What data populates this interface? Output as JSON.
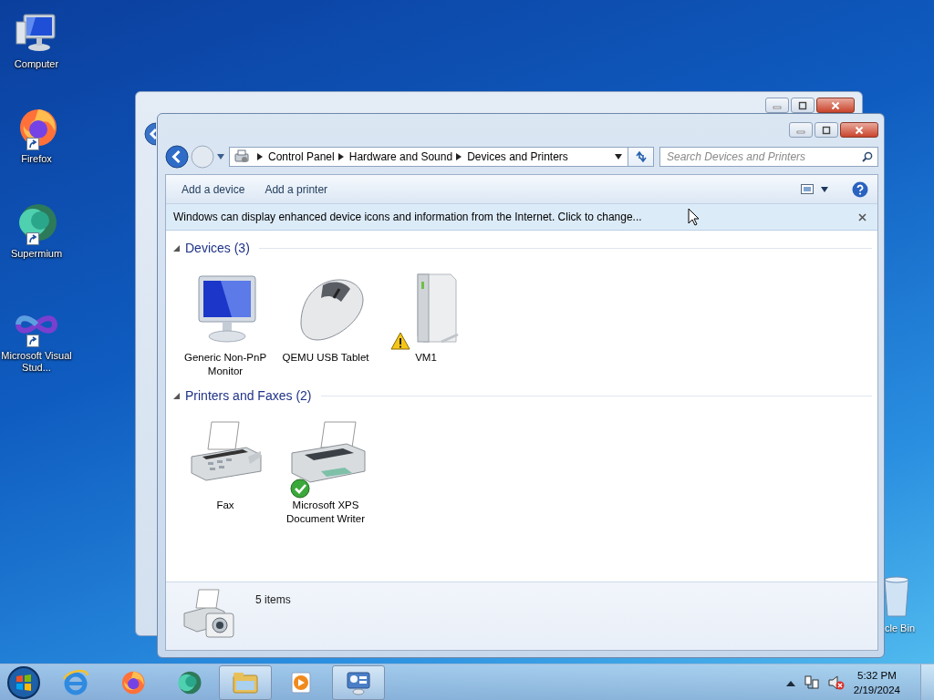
{
  "desktop_icons": [
    {
      "label": "Computer",
      "kind": "computer",
      "shortcut": false
    },
    {
      "label": "Firefox",
      "kind": "firefox",
      "shortcut": true
    },
    {
      "label": "Supermium",
      "kind": "supermium",
      "shortcut": true
    },
    {
      "label": "Microsoft Visual Stud...",
      "kind": "vs",
      "shortcut": true
    },
    {
      "label": "cle Bin",
      "kind": "recycle",
      "shortcut": false
    }
  ],
  "window": {
    "breadcrumb": [
      "Control Panel",
      "Hardware and Sound",
      "Devices and Printers"
    ],
    "search": {
      "placeholder": "Search Devices and Printers"
    },
    "toolbar": [
      "Add a device",
      "Add a printer"
    ],
    "info_bar": "Windows can display enhanced device icons and information from the Internet. Click to change...",
    "groups": [
      {
        "title": "Devices (3)",
        "expanded": true,
        "items": [
          {
            "label": "Generic Non-PnP Monitor",
            "kind": "monitor",
            "warning": false,
            "default": false
          },
          {
            "label": "QEMU USB Tablet",
            "kind": "mouse",
            "warning": false,
            "default": false
          },
          {
            "label": "VM1",
            "kind": "computer-case",
            "warning": true,
            "default": false
          }
        ]
      },
      {
        "title": "Printers and Faxes (2)",
        "expanded": true,
        "items": [
          {
            "label": "Fax",
            "kind": "fax",
            "warning": false,
            "default": false
          },
          {
            "label": "Microsoft XPS Document Writer",
            "kind": "printer",
            "warning": false,
            "default": true
          }
        ]
      }
    ],
    "details": "5 items"
  },
  "taskbar": {
    "items": [
      {
        "kind": "ie",
        "open": false
      },
      {
        "kind": "firefox",
        "open": false
      },
      {
        "kind": "supermium",
        "open": false
      },
      {
        "kind": "explorer",
        "open": true
      },
      {
        "kind": "media",
        "open": false
      },
      {
        "kind": "devices",
        "open": true
      }
    ],
    "time": "5:32 PM",
    "date": "2/19/2024"
  }
}
